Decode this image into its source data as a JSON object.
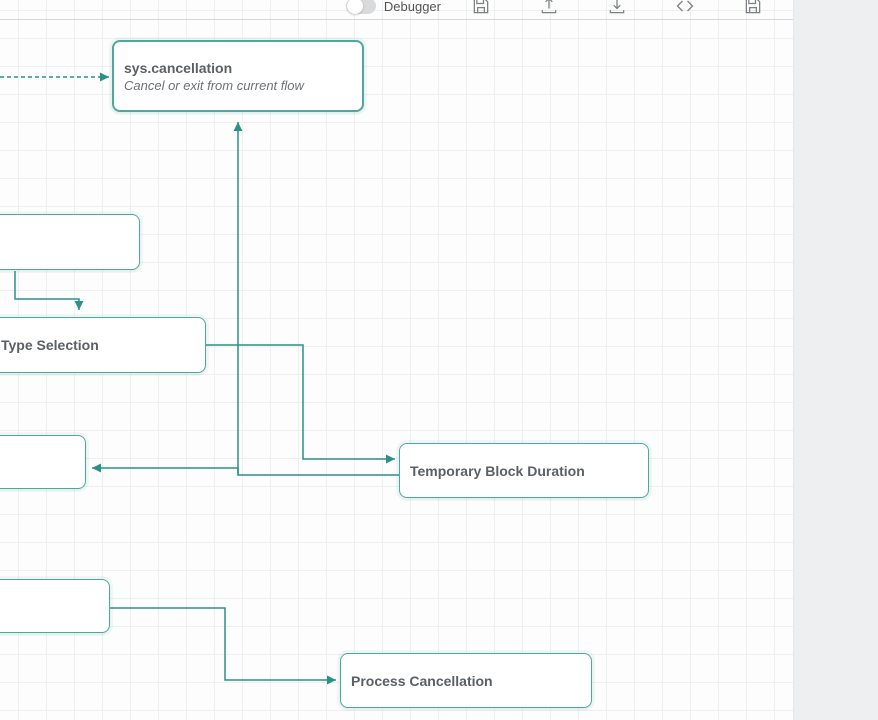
{
  "toolbar": {
    "debugger_label": "Debugger"
  },
  "nodes": {
    "cancellation": {
      "title": "sys.cancellation",
      "subtitle": "Cancel or exit from current flow"
    },
    "type_selection": {
      "title": "Type Selection"
    },
    "temp_block": {
      "title": "Temporary Block Duration"
    },
    "process_cancel": {
      "title": "Process Cancellation"
    }
  }
}
